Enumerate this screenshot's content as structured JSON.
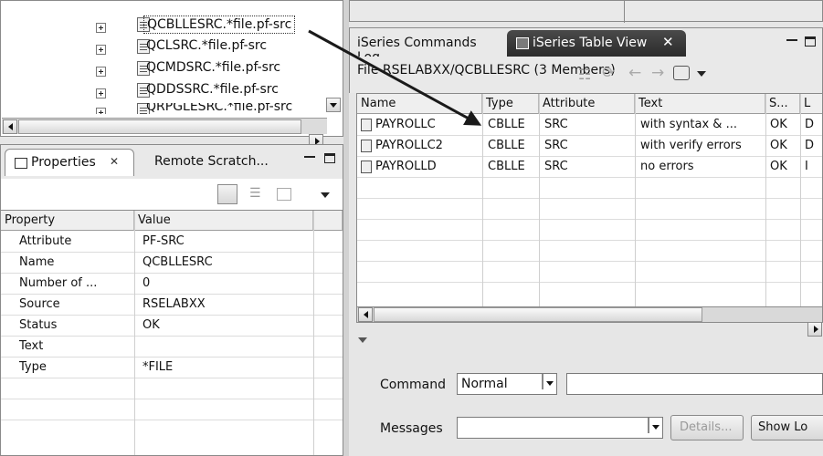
{
  "tree": {
    "items": [
      {
        "label": "QCBLLESRC.*file.pf-src",
        "selected": true
      },
      {
        "label": "QCLSRC.*file.pf-src"
      },
      {
        "label": "QCMDSRC.*file.pf-src"
      },
      {
        "label": "QDDSSRC.*file.pf-src"
      },
      {
        "label": "QRPGLESRC.*file.pf-src"
      }
    ]
  },
  "properties_view": {
    "tab_label": "Properties",
    "tab_close": "✕",
    "other_tab_label": "Remote Scratch...",
    "columns": [
      "Property",
      "Value"
    ],
    "rows": [
      {
        "property": "Attribute",
        "value": "PF-SRC"
      },
      {
        "property": "Name",
        "value": "QCBLLESRC"
      },
      {
        "property": "Number of ...",
        "value": "0"
      },
      {
        "property": "Source",
        "value": "RSELABXX"
      },
      {
        "property": "Status",
        "value": "OK"
      },
      {
        "property": "Text",
        "value": ""
      },
      {
        "property": "Type",
        "value": "*FILE"
      }
    ]
  },
  "right_tabs": {
    "commands_log": "iSeries Commands Log",
    "table_view": "iSeries Table View",
    "table_view_close": "✕"
  },
  "file_info": "File RSELABXX/QCBLLESRC (3 Members)",
  "table": {
    "columns": [
      "Name",
      "Type",
      "Attribute",
      "Text",
      "S...",
      "L"
    ],
    "rows": [
      {
        "name": "PAYROLLC",
        "type": "CBLLE",
        "attribute": "SRC",
        "text": "with syntax & ...",
        "status": "OK",
        "extra": "D"
      },
      {
        "name": "PAYROLLC2",
        "type": "CBLLE",
        "attribute": "SRC",
        "text": "with verify errors",
        "status": "OK",
        "extra": "D"
      },
      {
        "name": "PAYROLLD",
        "type": "CBLLE",
        "attribute": "SRC",
        "text": "no errors",
        "status": "OK",
        "extra": "I"
      }
    ]
  },
  "command_area": {
    "command_label": "Command",
    "command_mode": "Normal",
    "command_value": "",
    "messages_label": "Messages",
    "messages_value": "",
    "details_button": "Details...",
    "show_log_button": "Show Lo"
  },
  "colors": {
    "accent": "#0a246a",
    "arrow": "#1a1a1a",
    "panel_bg": "#e6e6e6"
  }
}
